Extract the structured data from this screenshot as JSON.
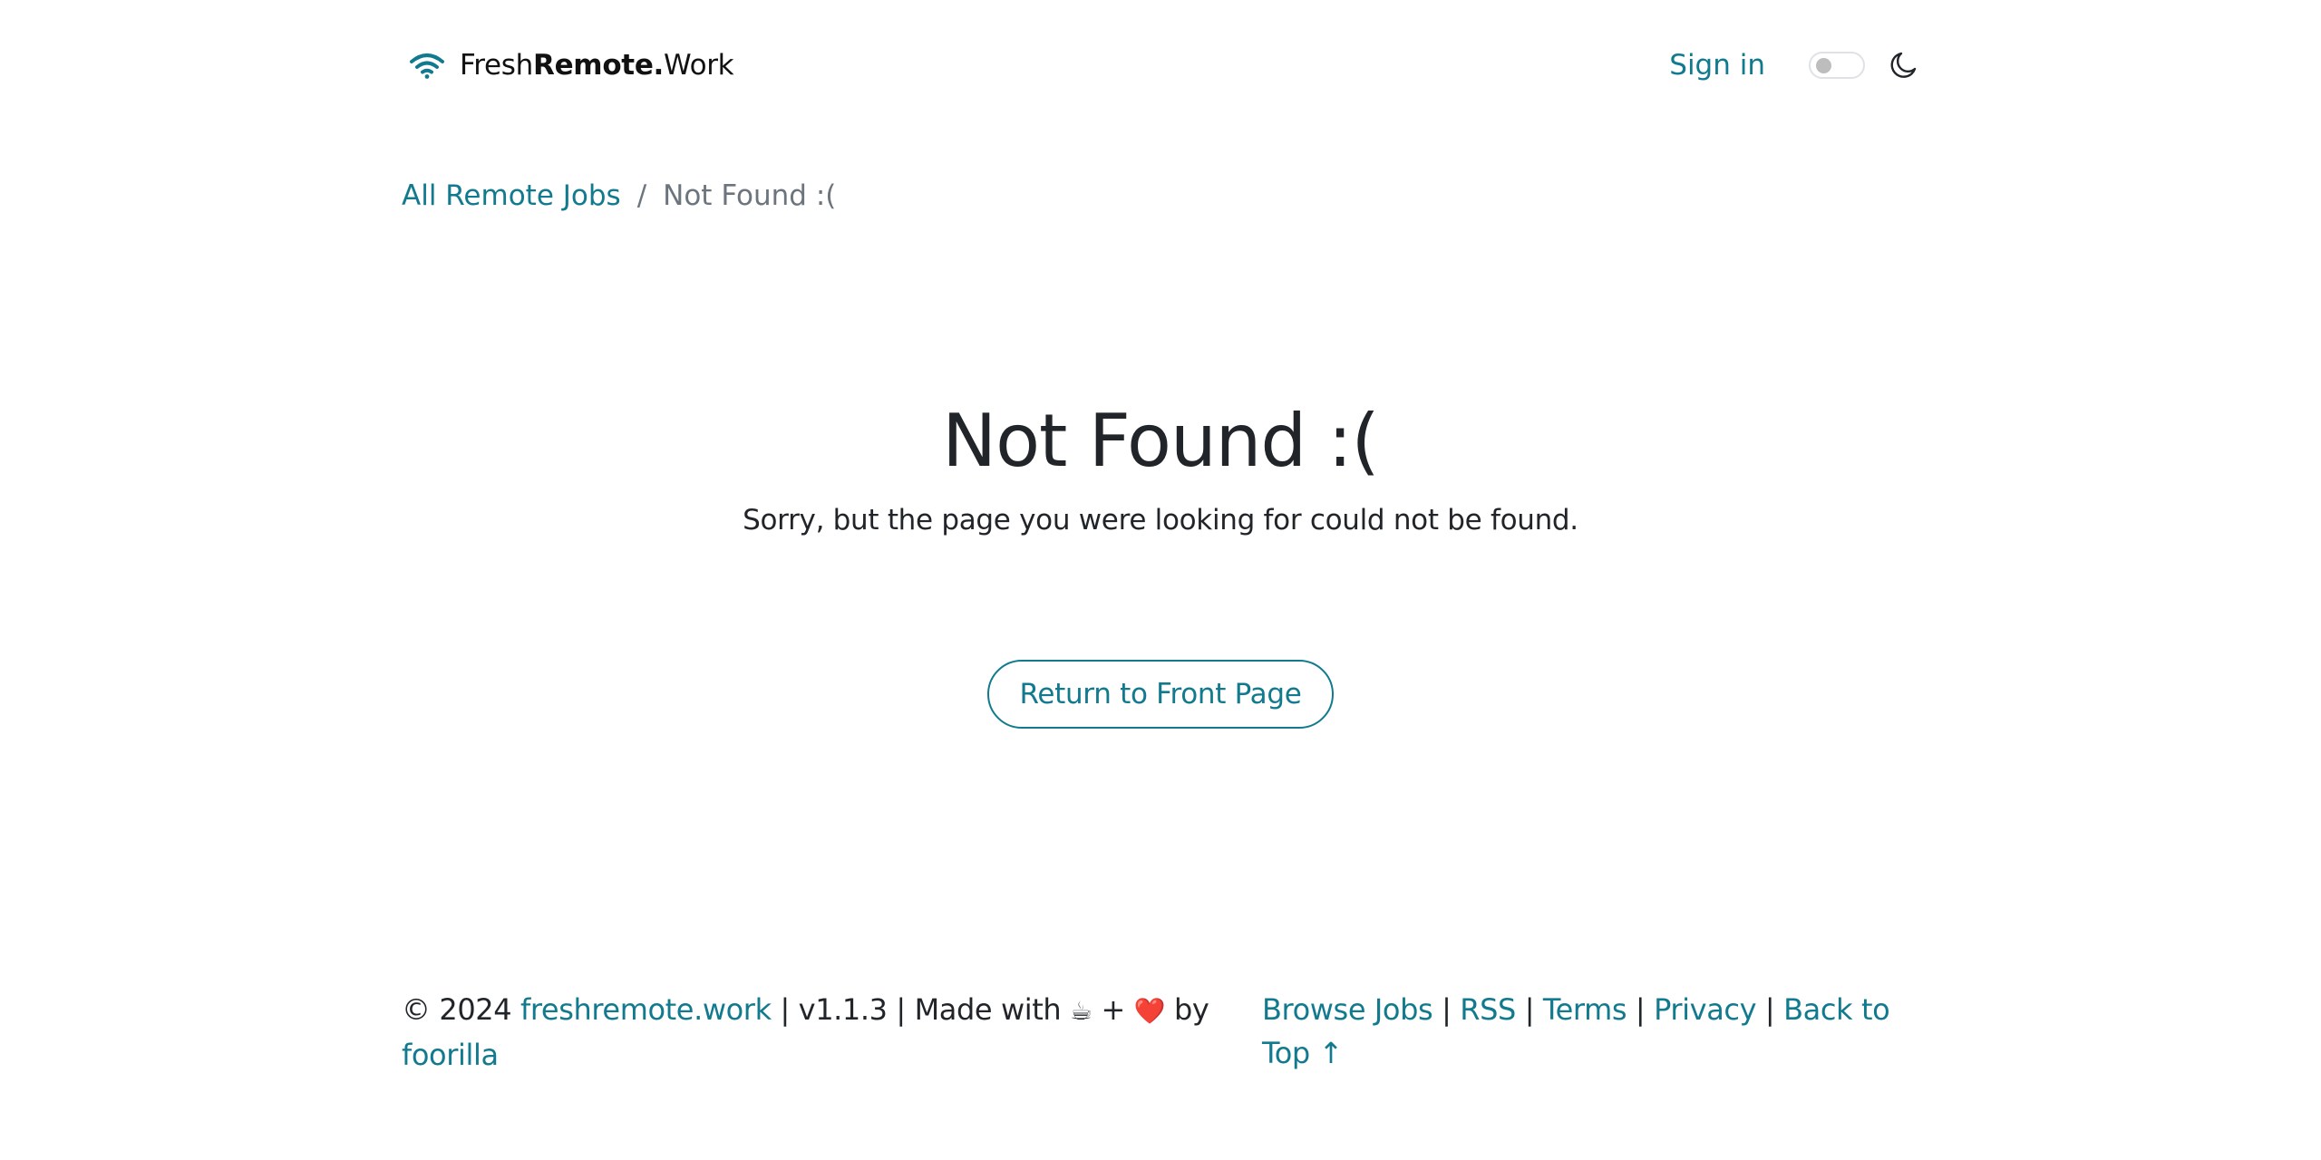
{
  "header": {
    "brand": {
      "prefix": "Fresh",
      "bold": "Remote.",
      "suffix": "Work",
      "icon": "wifi-icon"
    },
    "signin_label": "Sign in",
    "theme_toggle": {
      "state": "off",
      "icon": "moon-icon"
    }
  },
  "breadcrumb": {
    "items": [
      {
        "label": "All Remote Jobs"
      },
      {
        "label": "Not Found :("
      }
    ],
    "separator": "/"
  },
  "main": {
    "title": "Not Found :(",
    "message": "Sorry, but the page you were looking for could not be found.",
    "button_label": "Return to Front Page"
  },
  "footer": {
    "copyright": "© 2024",
    "site_link": "freshremote.work",
    "version": "v1.1.3",
    "made_with": "Made with",
    "coffee": "☕",
    "plus": "+",
    "heart": "❤️",
    "by": "by",
    "author": "foorilla",
    "separator": "|",
    "links": [
      {
        "label": "Browse Jobs"
      },
      {
        "label": "RSS"
      },
      {
        "label": "Terms"
      },
      {
        "label": "Privacy"
      },
      {
        "label": "Back to Top ↑"
      }
    ]
  },
  "colors": {
    "accent": "#127a8e",
    "text": "#212529",
    "muted": "#6c757d"
  }
}
